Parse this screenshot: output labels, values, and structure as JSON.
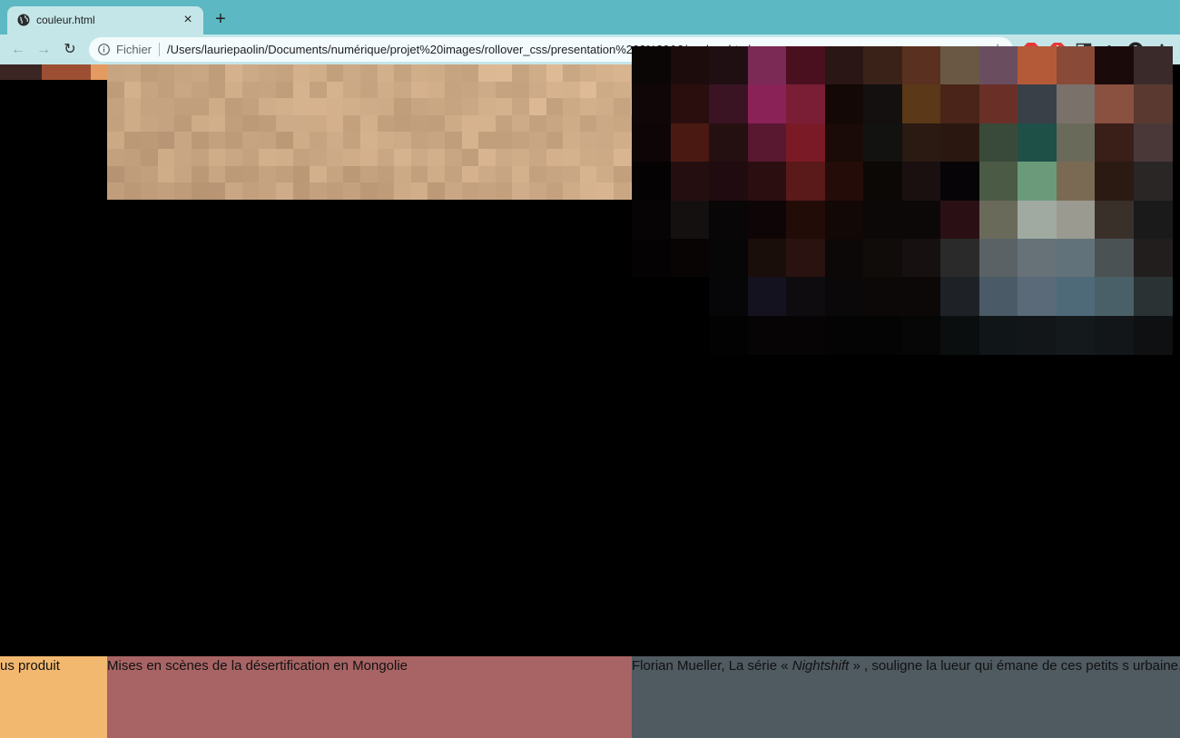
{
  "browser": {
    "tab_title": "couleur.html",
    "address_scheme": "Fichier",
    "address_url": "/Users/lauriepaolin/Documents/numérique/projet%20images/rollover_css/presentation%202%20&3/couleur.html",
    "extensions": [
      "abp-icon",
      "stop-icon",
      "sidebar-icon",
      "puzzle-icon",
      "account-icon",
      "menu-icon"
    ]
  },
  "captions": {
    "left": "us produit",
    "middle": "Mises en scènes de la désertification en Mongolie",
    "right_prefix": "Florian Mueller, La série ",
    "right_quote_open": "« ",
    "right_title": "Nightshift",
    "right_quote_close": " »",
    "right_suffix": " , souligne la lueur qui émane de ces petits s urbaine."
  },
  "colors": {
    "tab_strip": "#5cb8c2",
    "toolbar": "#c4e6e9",
    "caption_left": "#f2b86f",
    "caption_middle": "#a86464",
    "caption_right": "#4f5a61"
  }
}
